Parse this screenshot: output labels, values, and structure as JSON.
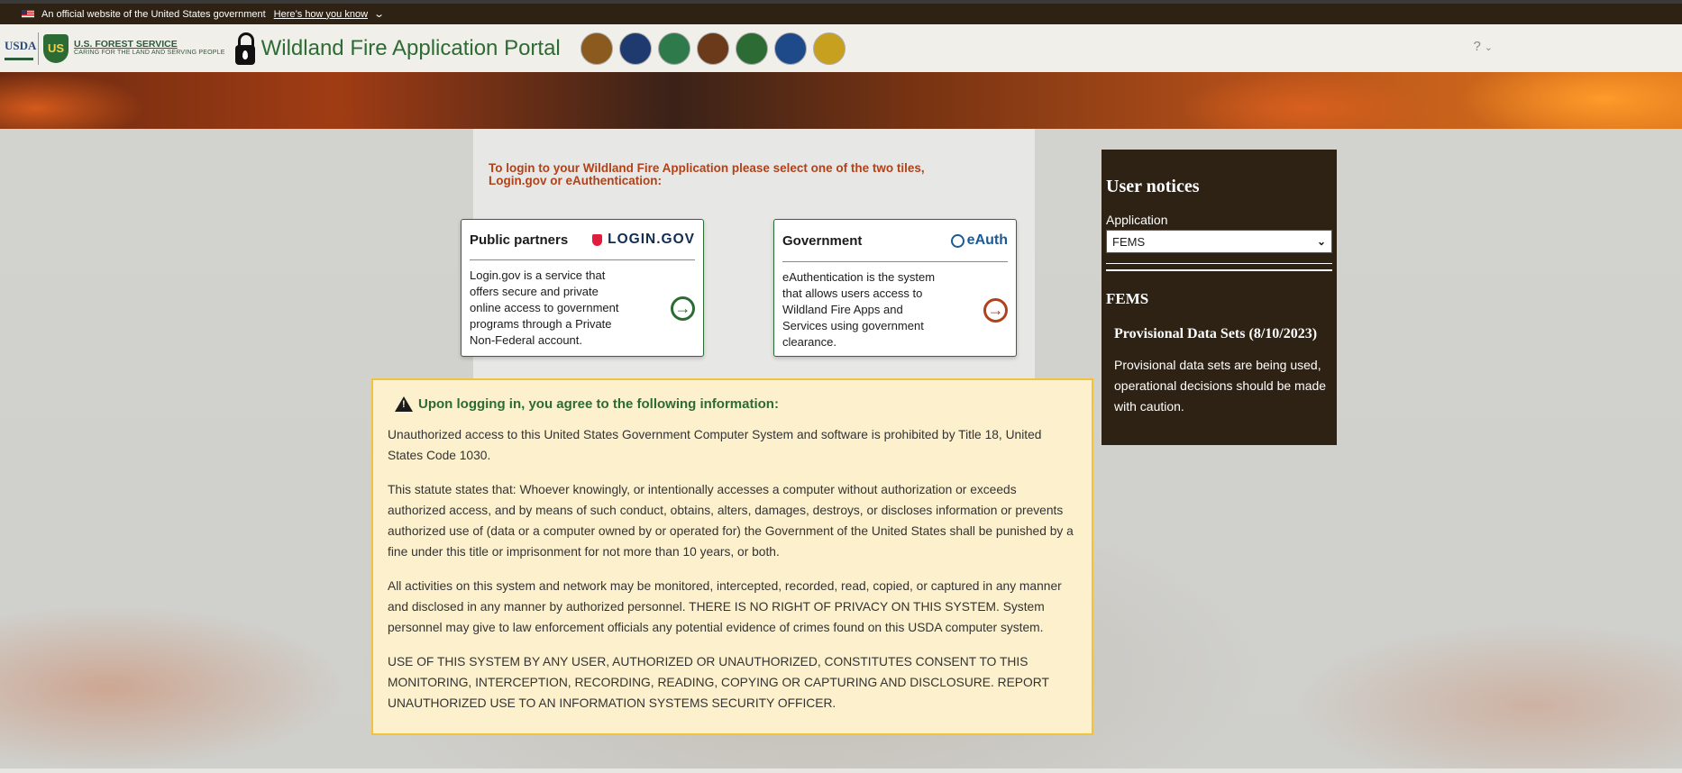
{
  "gov_banner": {
    "text": "An official website of the United States government",
    "link": "Here’s how you know"
  },
  "header": {
    "usda": "USDA",
    "fs_name": "U.S. FOREST SERVICE",
    "fs_tagline": "CARING FOR THE LAND AND SERVING PEOPLE",
    "portal_title": "Wildland Fire Application Portal",
    "agencies": [
      {
        "icon": "bia-seal-icon",
        "color": "#8a5a1e"
      },
      {
        "icon": "eagle-seal-icon",
        "color": "#1f3a6e"
      },
      {
        "icon": "blm-seal-icon",
        "color": "#2f7a4a"
      },
      {
        "icon": "nps-arrowhead-icon",
        "color": "#6b3a1a"
      },
      {
        "icon": "state-forester-seal-icon",
        "color": "#2d6b35"
      },
      {
        "icon": "dod-seal-icon",
        "color": "#1f4a8a"
      },
      {
        "icon": "fws-seal-icon",
        "color": "#c8a020"
      }
    ],
    "help": "?"
  },
  "login": {
    "instruction": "To login to your Wildland Fire Application please select one of the two tiles, Login.gov or eAuthentication:",
    "public": {
      "title": "Public partners",
      "logo": "LOGIN.GOV",
      "text": "Login.gov is a service that offers secure and private online access to government programs through a Private Non-Federal account."
    },
    "government": {
      "title": "Government",
      "logo": "eAuth",
      "text": "eAuthentication is the system that allows users access to Wildland Fire Apps and Services using government clearance."
    }
  },
  "agreement": {
    "title": "Upon logging in, you agree to the following information:",
    "paragraphs": [
      "Unauthorized access to this United States Government Computer System and software is prohibited by Title 18, United States Code 1030.",
      "This statute states that: Whoever knowingly, or intentionally accesses a computer without authorization or exceeds authorized access, and by means of such conduct, obtains, alters, damages, destroys, or discloses information or prevents authorized use of (data or a computer owned by or operated for) the Government of the United States shall be punished by a fine under this title or imprisonment for not more than 10 years, or both.",
      "All activities on this system and network may be monitored, intercepted, recorded, read, copied, or captured in any manner and disclosed in any manner by authorized personnel. THERE IS NO RIGHT OF PRIVACY ON THIS SYSTEM. System personnel may give to law enforcement officials any potential evidence of crimes found on this USDA computer system.",
      "USE OF THIS SYSTEM BY ANY USER, AUTHORIZED OR UNAUTHORIZED, CONSTITUTES CONSENT TO THIS MONITORING, INTERCEPTION, RECORDING, READING, COPYING OR CAPTURING AND DISCLOSURE. REPORT UNAUTHORIZED USE TO AN INFORMATION SYSTEMS SECURITY OFFICER."
    ]
  },
  "notices": {
    "title": "User notices",
    "app_label": "Application",
    "app_selected": "FEMS",
    "app_name": "FEMS",
    "notice_title": "Provisional Data Sets (8/10/2023)",
    "notice_text": "Provisional data sets are being used, operational decisions should be made with caution."
  },
  "colors": {
    "brand_green": "#2d6b35",
    "accent_orange": "#b0421a",
    "dark_brown": "#2e2214",
    "warning_bg": "#fdf0cd"
  }
}
